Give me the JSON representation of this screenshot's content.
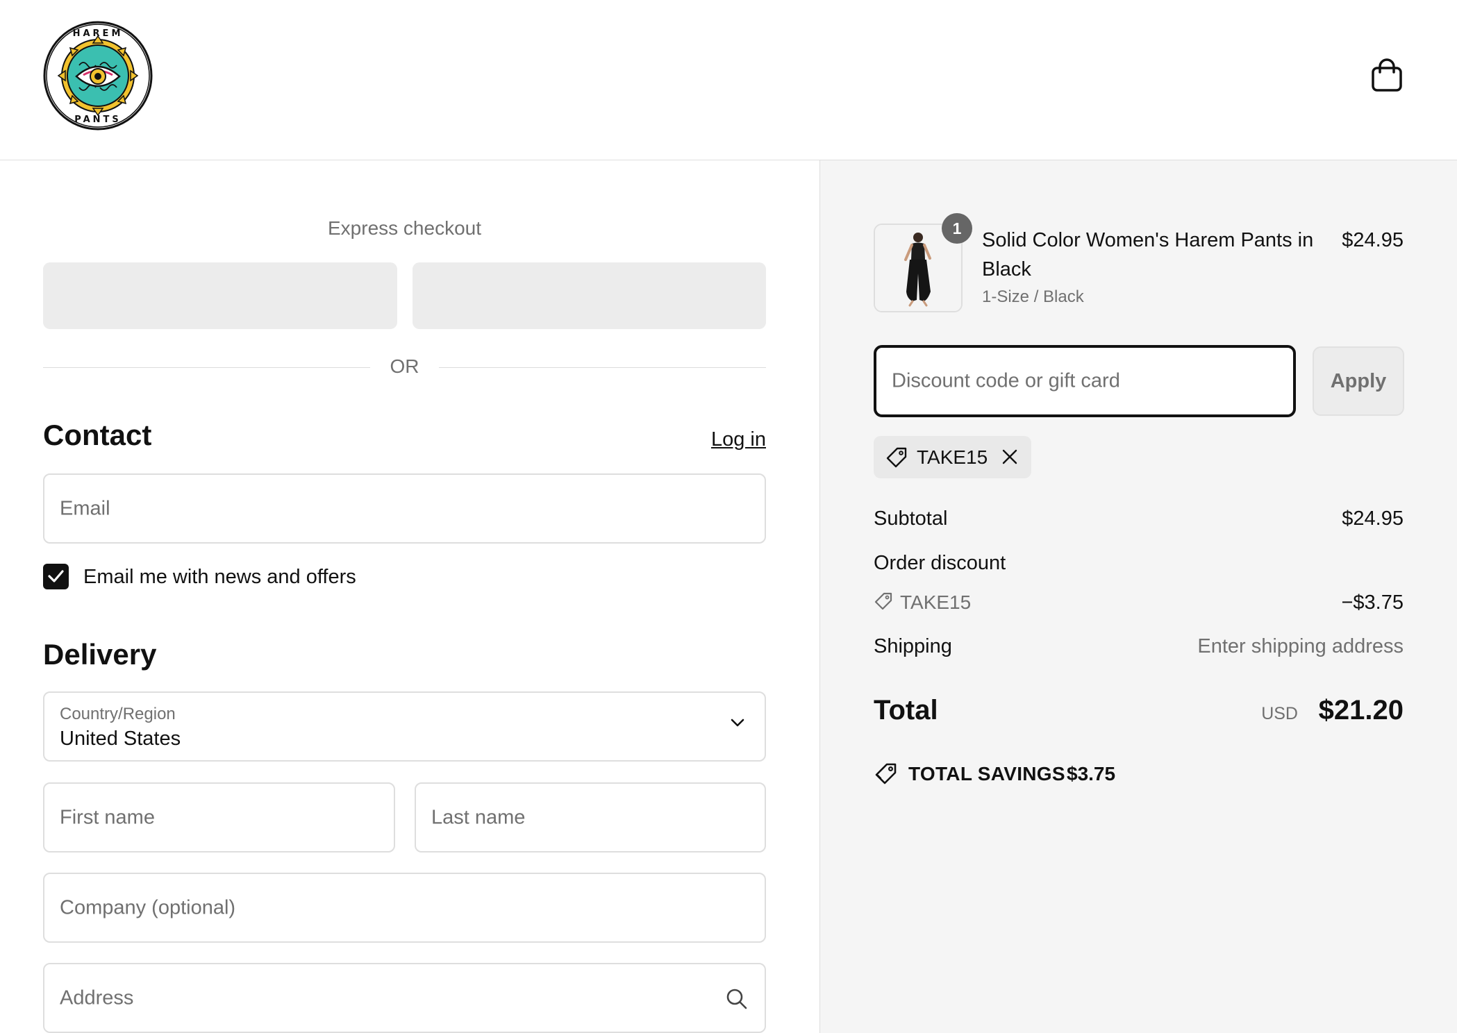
{
  "brand": {
    "logo_text_top": "HAREM",
    "logo_text_bottom": "PANTS"
  },
  "header": {
    "cart_icon": "shopping-bag-icon"
  },
  "express": {
    "title": "Express checkout",
    "divider": "OR"
  },
  "contact": {
    "title": "Contact",
    "login_label": "Log in",
    "email_placeholder": "Email",
    "newsletter_label": "Email me with news and offers",
    "newsletter_checked": true
  },
  "delivery": {
    "title": "Delivery",
    "country_label": "Country/Region",
    "country_value": "United States",
    "first_name_placeholder": "First name",
    "last_name_placeholder": "Last name",
    "company_placeholder": "Company (optional)",
    "address_placeholder": "Address"
  },
  "order": {
    "product_name": "Solid Color Women's Harem Pants in Black",
    "product_variant": "1-Size / Black",
    "product_price": "$24.95",
    "quantity": "1",
    "discount_placeholder": "Discount code or gift card",
    "apply_label": "Apply",
    "applied_code": "TAKE15"
  },
  "summary": {
    "subtotal_label": "Subtotal",
    "subtotal_value": "$24.95",
    "order_discount_label": "Order discount",
    "discount_code": "TAKE15",
    "discount_value": "−$3.75",
    "shipping_label": "Shipping",
    "shipping_value": "Enter shipping address",
    "total_label": "Total",
    "total_currency": "USD",
    "total_value": "$21.20",
    "savings_label": "TOTAL SAVINGS",
    "savings_value": "$3.75"
  },
  "colors": {
    "accent": "#111111",
    "logo_teal": "#3bbfb0",
    "logo_yellow": "#f2c22e",
    "muted": "#707070"
  }
}
